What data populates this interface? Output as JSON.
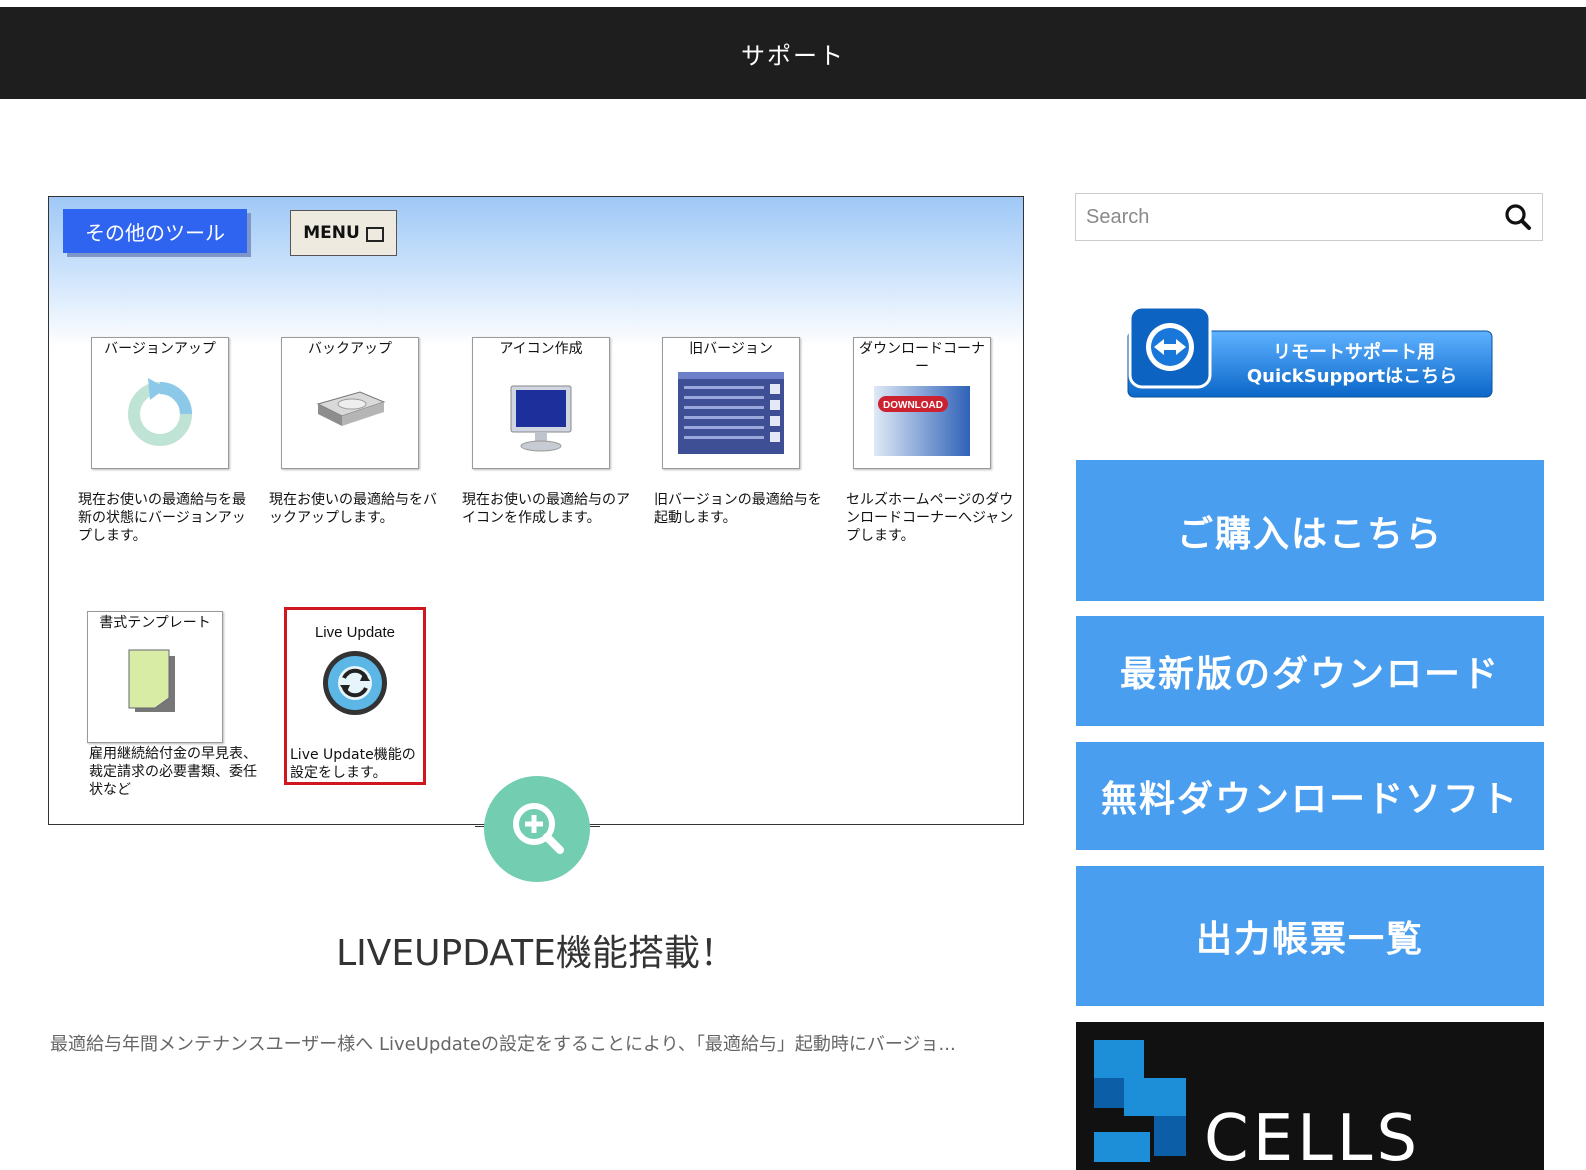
{
  "header": {
    "title": "サポート"
  },
  "screenshot": {
    "tools_label": "その他のツール",
    "menu_label": "MENU",
    "tiles": [
      {
        "label": "バージョンアップ",
        "desc": "現在お使いの最適給与を最新の状態にバージョンアップします。"
      },
      {
        "label": "バックアップ",
        "desc": "現在お使いの最適給与をバックアップします。"
      },
      {
        "label": "アイコン作成",
        "desc": "現在お使いの最適給与のアイコンを作成します。"
      },
      {
        "label": "旧バージョン",
        "desc": "旧バージョンの最適給与を起動します。"
      },
      {
        "label": "ダウンロードコーナー",
        "desc": "セルズホームページのダウンロードコーナーへジャンプします。",
        "image_text": "DOWNLOAD"
      },
      {
        "label": "書式テンプレート",
        "desc": "雇用継続給付金の早見表、裁定請求の必要書類、委任状など"
      },
      {
        "label": "Live Update",
        "desc": "Live Update機能の設定をします。"
      }
    ]
  },
  "post": {
    "title": "LIVEUPDATE機能搭載！",
    "excerpt": "最適給与年間メンテナンスユーザー様へ LiveUpdateの設定をすることにより、「最適給与」起動時にバージョ..."
  },
  "sidebar": {
    "search_placeholder": "Search",
    "quicksupport": {
      "line1": "リモートサポート用",
      "line2": "QuickSupportはこちら"
    },
    "buttons": [
      "ご購入はこちら",
      "最新版のダウンロード",
      "無料ダウンロードソフト",
      "出力帳票一覧"
    ],
    "logo_text": "CELLS"
  },
  "colors": {
    "button_blue": "#4a9ef0",
    "zoom_green": "#72cdb1",
    "header_bg": "#1e1e1e",
    "tools_blue": "#2f64f0",
    "highlight_red": "#d0161e"
  }
}
